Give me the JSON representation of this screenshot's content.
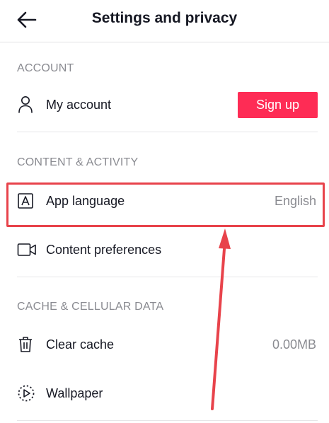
{
  "header": {
    "title": "Settings and privacy"
  },
  "sections": {
    "account": {
      "label": "ACCOUNT",
      "my_account_label": "My account",
      "signup_label": "Sign up"
    },
    "content": {
      "label": "CONTENT & ACTIVITY",
      "app_language_label": "App language",
      "app_language_value": "English",
      "content_prefs_label": "Content preferences"
    },
    "cache": {
      "label": "CACHE & CELLULAR DATA",
      "clear_cache_label": "Clear cache",
      "clear_cache_value": "0.00MB",
      "wallpaper_label": "Wallpaper"
    }
  },
  "colors": {
    "accent": "#fe2c55",
    "annotation": "#e8434b"
  },
  "icons": [
    "arrow-left-icon",
    "person-icon",
    "language-icon",
    "video-camera-icon",
    "trash-icon",
    "wallpaper-play-icon"
  ]
}
